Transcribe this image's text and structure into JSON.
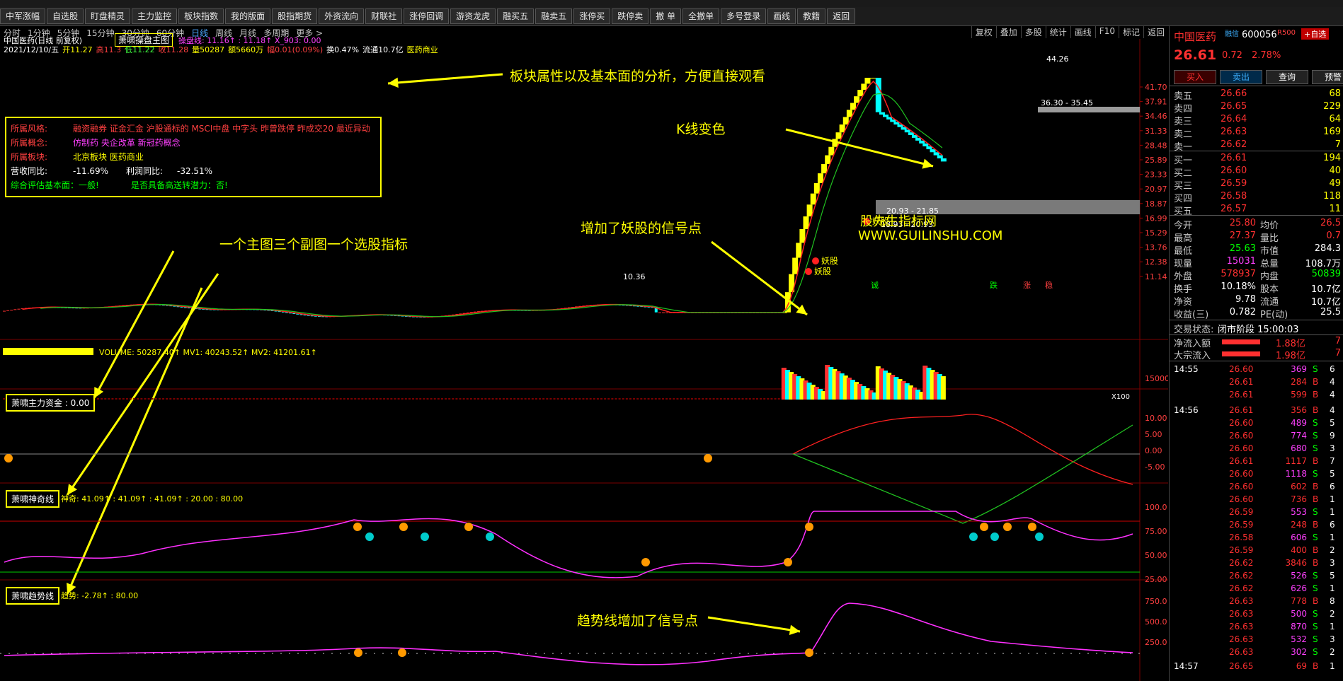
{
  "toolbar": {
    "buttons": [
      "中军涨幅",
      "自选股",
      "盯盘精灵",
      "主力监控",
      "板块指数",
      "我的版面",
      "股指期货",
      "外资流向",
      "财联社",
      "涨停回调",
      "游资龙虎",
      "融买五",
      "融卖五",
      "涨停买",
      "跌停卖",
      "撤 单",
      "全撤单",
      "多号登录",
      "画线",
      "教籍",
      "返回"
    ]
  },
  "periods": {
    "items": [
      "分时",
      "1分钟",
      "5分钟",
      "15分钟",
      "30分钟",
      "60分钟",
      "日线",
      "周线",
      "月线",
      "多周期",
      "更多 >"
    ],
    "active": "日线",
    "right_items": [
      "复权",
      "叠加",
      "多股",
      "统计",
      "画线",
      "F10",
      "标记",
      "返回"
    ]
  },
  "main_chart": {
    "title": "中国医药(日线 前复权)",
    "main_indicator": "萧啸操盘主图",
    "indicator_values": "操盘线: 11.16↑  : 11.18↑  X_903: 0.00",
    "bar_info": [
      "2021/12/10/五",
      "开11.27",
      "高11.3",
      "低11.22",
      "收11.28",
      "量50287",
      "额5660万",
      "幅0.01(0.09%)",
      "换0.47%",
      "流通10.7亿",
      "医药商业"
    ],
    "price_ticks": [
      "41.70",
      "37.91",
      "34.46",
      "31.33",
      "28.48",
      "25.89",
      "23.33",
      "20.97",
      "18.87",
      "16.99",
      "15.29",
      "13.76",
      "12.38",
      "11.14"
    ],
    "max_label": "44.26",
    "min_label": "10.36",
    "band1": "36.30 - 35.45",
    "band2": "20.93 - 21.85",
    "band3": "18.93 - 20.93",
    "signal_labels": [
      "妖股",
      "妖股",
      "妖股"
    ],
    "bottom_marks": [
      "诚",
      "跌",
      "涨",
      "稳"
    ]
  },
  "info_box": {
    "rows": [
      {
        "k": "所属风格:",
        "v": "融资融券 证金汇金 沪股通标的 MSCI中盘 中字头 昨曾跌停 昨成交20 最近异动"
      },
      {
        "k": "所属概念:",
        "v": "仿制药 央企改革 新冠药概念"
      },
      {
        "k": "所属板块:",
        "v": "北京板块  医药商业"
      },
      {
        "k": "营收同比:",
        "v": "-11.69%",
        "k2": "利润同比:",
        "v2": "-32.51%"
      },
      {
        "k": "综合评估基本面：一般!",
        "v": "是否具备高送转潜力：否!"
      }
    ]
  },
  "volume_panel": {
    "header": "VOLUME: 50287.40↑  MV1: 40243.52↑  MV2: 41201.61↑",
    "ticks": [
      "15000",
      "X100"
    ]
  },
  "fund_panel": {
    "label": "萧啸主力资金 : 0.00",
    "ticks": [
      "10.00",
      "5.00",
      "0.00",
      "-5.00"
    ]
  },
  "magic_panel": {
    "label": "萧啸神奇线",
    "header": "神奇: 41.09↑  : 41.09↑  : 41.09↑  : 20.00  : 80.00",
    "ticks": [
      "100.0",
      "75.00",
      "50.00",
      "25.00"
    ]
  },
  "trend_panel": {
    "label": "萧啸趋势线",
    "header": "趋势: -2.78↑  : 80.00",
    "ticks": [
      "750.0",
      "500.0",
      "250.0"
    ]
  },
  "annotations": {
    "a1": "板块属性以及基本面的分析，方便直接观看",
    "a2": "K线变色",
    "a3": "增加了妖股的信号点",
    "a4": "一个主图三个副图一个选股指标",
    "a5": "趋势线增加了信号点",
    "wm1": "股先生指标网",
    "wm2": "WWW.GUILINSHU.COM"
  },
  "sidebar": {
    "name": "中国医药",
    "sub": "融信",
    "code": "600056",
    "tag": "R500",
    "add_btn": "+自选",
    "price": "26.61",
    "change": "0.72",
    "pct": "2.78%",
    "buttons": [
      "买入",
      "卖出",
      "查询",
      "预警"
    ],
    "asks": [
      {
        "l": "卖五",
        "p": "26.66",
        "v": "68"
      },
      {
        "l": "卖四",
        "p": "26.65",
        "v": "229"
      },
      {
        "l": "卖三",
        "p": "26.64",
        "v": "64"
      },
      {
        "l": "卖二",
        "p": "26.63",
        "v": "169"
      },
      {
        "l": "卖一",
        "p": "26.62",
        "v": "7"
      }
    ],
    "bids": [
      {
        "l": "买一",
        "p": "26.61",
        "v": "194"
      },
      {
        "l": "买二",
        "p": "26.60",
        "v": "40"
      },
      {
        "l": "买三",
        "p": "26.59",
        "v": "49"
      },
      {
        "l": "买四",
        "p": "26.58",
        "v": "118"
      },
      {
        "l": "买五",
        "p": "26.57",
        "v": "11"
      }
    ],
    "stats": [
      {
        "l1": "今开",
        "v1": "25.80",
        "l2": "均价",
        "v2": "26.5"
      },
      {
        "l1": "最高",
        "v1": "27.37",
        "l2": "量比",
        "v2": "0.7"
      },
      {
        "l1": "最低",
        "v1": "25.63",
        "l2": "市值",
        "v2": "284.3"
      },
      {
        "l1": "现量",
        "v1": "15031",
        "l2": "总量",
        "v2": "108.7万"
      },
      {
        "l1": "外盘",
        "v1": "578937",
        "l2": "内盘",
        "v2": "50839"
      },
      {
        "l1": "换手",
        "v1": "10.18%",
        "l2": "股本",
        "v2": "10.7亿"
      },
      {
        "l1": "净资",
        "v1": "9.78",
        "l2": "流通",
        "v2": "10.7亿"
      },
      {
        "l1": "收益(三)",
        "v1": "0.782",
        "l2": "PE(动)",
        "v2": "25.5"
      }
    ],
    "trade_status_label": "交易状态:",
    "trade_status": "闭市阶段 15:00:03",
    "flows": [
      {
        "l": "净流入额",
        "v": "1.88亿",
        "p": "7"
      },
      {
        "l": "大宗流入",
        "v": "1.98亿",
        "p": "7"
      }
    ],
    "ticks": [
      {
        "t": "14:55",
        "p": "26.60",
        "v": "369",
        "s": "S",
        "x": "6"
      },
      {
        "t": "",
        "p": "26.61",
        "v": "284",
        "s": "B",
        "x": "4"
      },
      {
        "t": "",
        "p": "26.61",
        "v": "599",
        "s": "B",
        "x": "4"
      },
      {
        "t": "14:56",
        "p": "26.61",
        "v": "356",
        "s": "B",
        "x": "4"
      },
      {
        "t": "",
        "p": "26.60",
        "v": "489",
        "s": "S",
        "x": "5"
      },
      {
        "t": "",
        "p": "26.60",
        "v": "774",
        "s": "S",
        "x": "9"
      },
      {
        "t": "",
        "p": "26.60",
        "v": "680",
        "s": "S",
        "x": "3"
      },
      {
        "t": "",
        "p": "26.61",
        "v": "1117",
        "s": "B",
        "x": "7"
      },
      {
        "t": "",
        "p": "26.60",
        "v": "1118",
        "s": "S",
        "x": "5"
      },
      {
        "t": "",
        "p": "26.60",
        "v": "602",
        "s": "B",
        "x": "6"
      },
      {
        "t": "",
        "p": "26.60",
        "v": "736",
        "s": "B",
        "x": "1"
      },
      {
        "t": "",
        "p": "26.59",
        "v": "553",
        "s": "S",
        "x": "1"
      },
      {
        "t": "",
        "p": "26.59",
        "v": "248",
        "s": "B",
        "x": "6"
      },
      {
        "t": "",
        "p": "26.58",
        "v": "606",
        "s": "S",
        "x": "1"
      },
      {
        "t": "",
        "p": "26.59",
        "v": "400",
        "s": "B",
        "x": "2"
      },
      {
        "t": "",
        "p": "26.62",
        "v": "3846",
        "s": "B",
        "x": "3"
      },
      {
        "t": "",
        "p": "26.62",
        "v": "526",
        "s": "S",
        "x": "5"
      },
      {
        "t": "",
        "p": "26.62",
        "v": "626",
        "s": "S",
        "x": "1"
      },
      {
        "t": "",
        "p": "26.63",
        "v": "778",
        "s": "B",
        "x": "8"
      },
      {
        "t": "",
        "p": "26.63",
        "v": "500",
        "s": "S",
        "x": "2"
      },
      {
        "t": "",
        "p": "26.63",
        "v": "870",
        "s": "S",
        "x": "1"
      },
      {
        "t": "",
        "p": "26.63",
        "v": "532",
        "s": "S",
        "x": "3"
      },
      {
        "t": "",
        "p": "26.63",
        "v": "302",
        "s": "S",
        "x": "2"
      },
      {
        "t": "14:57",
        "p": "26.65",
        "v": "69",
        "s": "B",
        "x": "1"
      }
    ]
  }
}
